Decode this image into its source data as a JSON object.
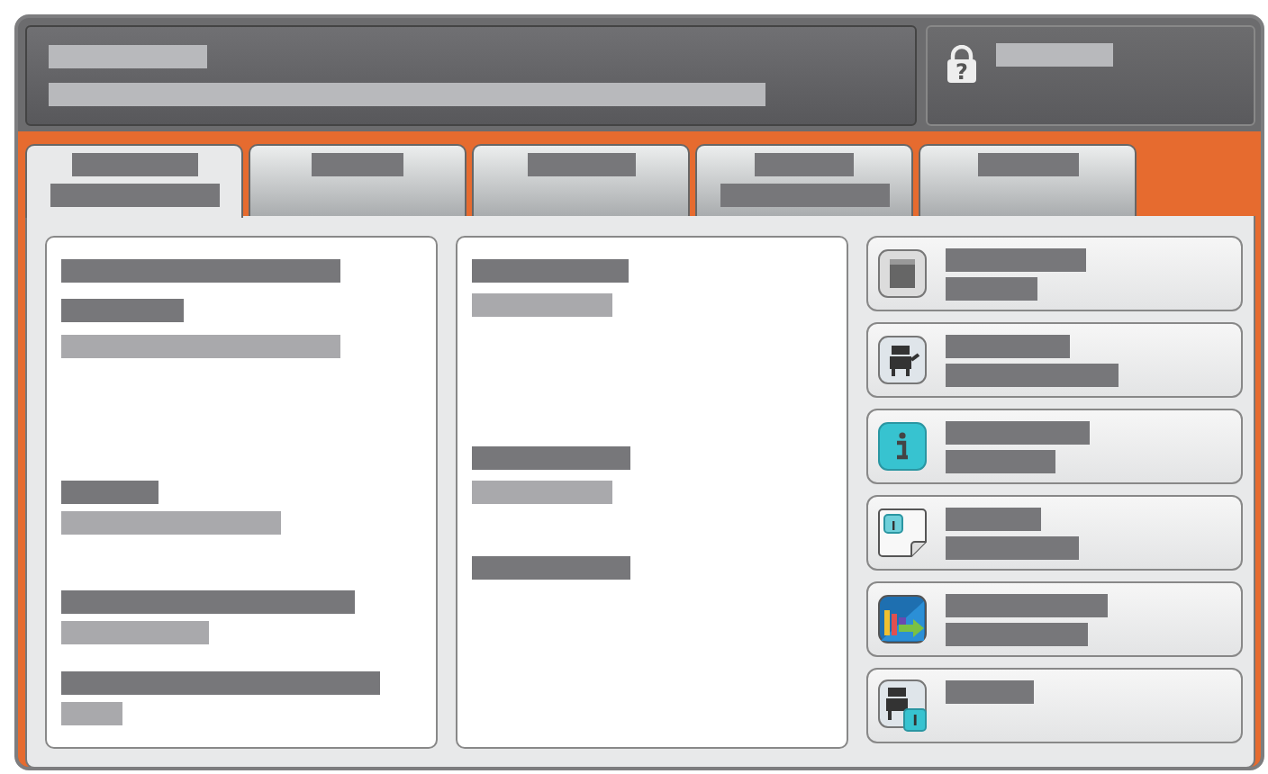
{
  "header": {
    "help_glyph": "?"
  },
  "tabs": [
    {
      "selected": true
    },
    {
      "selected": false
    },
    {
      "selected": false
    },
    {
      "selected": false
    },
    {
      "selected": false
    }
  ],
  "buttons": [
    {
      "kind": "tray"
    },
    {
      "kind": "printer"
    },
    {
      "kind": "info"
    },
    {
      "kind": "note"
    },
    {
      "kind": "chart"
    },
    {
      "kind": "printer-info"
    }
  ]
}
